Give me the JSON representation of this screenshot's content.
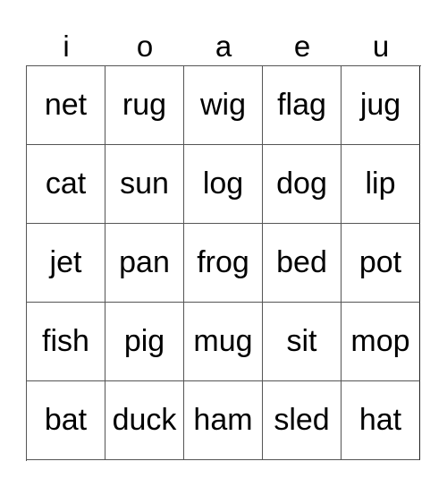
{
  "header": [
    "i",
    "o",
    "a",
    "e",
    "u"
  ],
  "rows": [
    [
      "net",
      "rug",
      "wig",
      "flag",
      "jug"
    ],
    [
      "cat",
      "sun",
      "log",
      "dog",
      "lip"
    ],
    [
      "jet",
      "pan",
      "frog",
      "bed",
      "pot"
    ],
    [
      "fish",
      "pig",
      "mug",
      "sit",
      "mop"
    ],
    [
      "bat",
      "duck",
      "ham",
      "sled",
      "hat"
    ]
  ]
}
